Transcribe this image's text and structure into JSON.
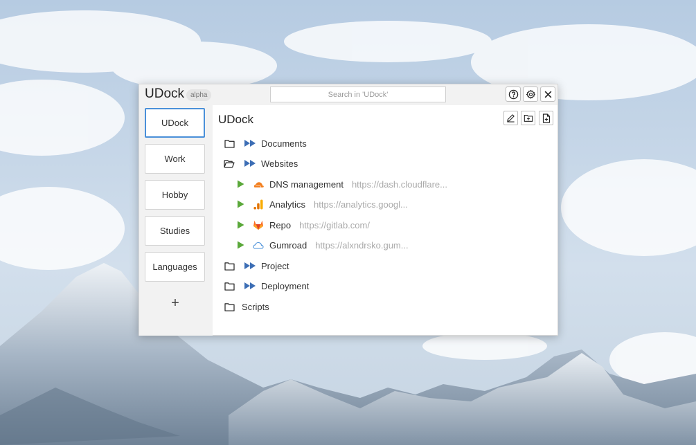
{
  "window": {
    "title": "UDock",
    "badge": "alpha",
    "search_placeholder": "Search in 'UDock'"
  },
  "sidebar": {
    "items": [
      {
        "label": "UDock",
        "active": true
      },
      {
        "label": "Work"
      },
      {
        "label": "Hobby"
      },
      {
        "label": "Studies"
      },
      {
        "label": "Languages"
      }
    ],
    "add_label": "+"
  },
  "main": {
    "title": "UDock",
    "tree": [
      {
        "type": "folder",
        "label": "Documents",
        "expanded": false,
        "icon": "folder-icon"
      },
      {
        "type": "folder",
        "label": "Websites",
        "expanded": true,
        "icon": "folder-open-icon"
      },
      {
        "type": "link",
        "label": "DNS management",
        "url": "https://dash.cloudflare...",
        "icon": "cloudflare-icon"
      },
      {
        "type": "link",
        "label": "Analytics",
        "url": "https://analytics.googl...",
        "icon": "google-analytics-icon"
      },
      {
        "type": "link",
        "label": "Repo",
        "url": "https://gitlab.com/",
        "icon": "gitlab-icon"
      },
      {
        "type": "link",
        "label": "Gumroad",
        "url": "https://alxndrsko.gum...",
        "icon": "cloud-icon"
      },
      {
        "type": "folder",
        "label": "Project",
        "expanded": false,
        "icon": "folder-icon"
      },
      {
        "type": "folder",
        "label": "Deployment",
        "expanded": false,
        "icon": "folder-icon"
      },
      {
        "type": "folder",
        "label": "Scripts",
        "expanded": false,
        "icon": "folder-icon",
        "no_run": true
      }
    ]
  },
  "colors": {
    "accent": "#4a90d9",
    "run_folder": "#3d6eb5",
    "run_link": "#5aa83a"
  }
}
